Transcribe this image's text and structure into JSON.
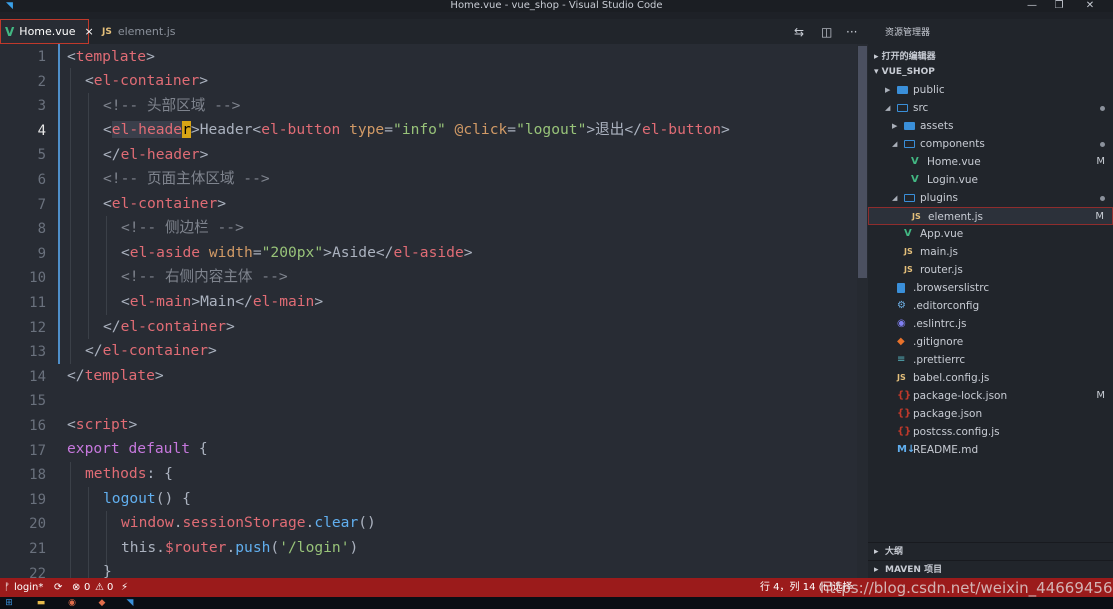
{
  "window": {
    "title": "Home.vue - vue_shop - Visual Studio Code",
    "app_icon": "vscode-icon",
    "controls": {
      "minimize": "—",
      "maximize": "❐",
      "close": "✕"
    }
  },
  "tabs": [
    {
      "label": "Home.vue",
      "type_badge": "V",
      "active": true,
      "close": "×"
    },
    {
      "label": "element.js",
      "type_badge": "JS",
      "active": false
    }
  ],
  "editor_actions": [
    "compare-icon",
    "split-icon",
    "more-icon"
  ],
  "editor_actions_glyphs": [
    "⇆",
    "◫",
    "···"
  ],
  "editor": {
    "current_line": 4,
    "lines": [
      {
        "n": "1"
      },
      {
        "n": "2"
      },
      {
        "n": "3"
      },
      {
        "n": "4"
      },
      {
        "n": "5"
      },
      {
        "n": "6"
      },
      {
        "n": "7"
      },
      {
        "n": "8"
      },
      {
        "n": "9"
      },
      {
        "n": "10"
      },
      {
        "n": "11"
      },
      {
        "n": "12"
      },
      {
        "n": "13"
      },
      {
        "n": "14"
      },
      {
        "n": "15"
      },
      {
        "n": "16"
      },
      {
        "n": "17"
      },
      {
        "n": "18"
      },
      {
        "n": "19"
      },
      {
        "n": "20"
      },
      {
        "n": "21"
      },
      {
        "n": "22"
      }
    ],
    "code": {
      "l1": [
        "<",
        "template",
        ">"
      ],
      "l2": [
        "<",
        "el-container",
        ">"
      ],
      "l3": [
        "<!-- ",
        "头部区域",
        " -->"
      ],
      "l4": [
        "<",
        "el-heade",
        "r",
        ">",
        "Header",
        "<",
        "el-button",
        " ",
        "type",
        "=",
        "\"info\"",
        " ",
        "@click",
        "=",
        "\"logout\"",
        ">",
        "退出",
        "</",
        "el-button",
        ">"
      ],
      "l5": [
        "</",
        "el-header",
        ">"
      ],
      "l6": [
        "<!-- ",
        "页面主体区域",
        " -->"
      ],
      "l7": [
        "<",
        "el-container",
        ">"
      ],
      "l8": [
        "<!-- ",
        "侧边栏",
        " -->"
      ],
      "l9": [
        "<",
        "el-aside",
        " ",
        "width",
        "=",
        "\"200px\"",
        ">",
        "Aside",
        "</",
        "el-aside",
        ">"
      ],
      "l10": [
        "<!-- ",
        "右侧内容主体",
        " -->"
      ],
      "l11": [
        "<",
        "el-main",
        ">",
        "Main",
        "</",
        "el-main",
        ">"
      ],
      "l12": [
        "</",
        "el-container",
        ">"
      ],
      "l13": [
        "</",
        "el-container",
        ">"
      ],
      "l14": [
        "</",
        "template",
        ">"
      ],
      "l16": [
        "<",
        "script",
        ">"
      ],
      "l17": [
        "export",
        " ",
        "default",
        " {"
      ],
      "l18": [
        "methods",
        ": {"
      ],
      "l19": [
        "logout",
        "() {"
      ],
      "l20": [
        "window",
        ".",
        "sessionStorage",
        ".",
        "clear",
        "()"
      ],
      "l21": [
        "this",
        ".",
        "$router",
        ".",
        "push",
        "(",
        "'/login'",
        ")"
      ],
      "l22": [
        "}"
      ]
    }
  },
  "sidebar": {
    "title": "资源管理器",
    "sections": {
      "open_editors": "打开的编辑器",
      "project": "VUE_SHOP",
      "outline": "大纲",
      "maven": "MAVEN 项目"
    },
    "tree": [
      {
        "label": "public",
        "kind": "folder",
        "depth": 1,
        "expanded": false
      },
      {
        "label": "src",
        "kind": "folder",
        "depth": 1,
        "expanded": true
      },
      {
        "label": "assets",
        "kind": "folder",
        "depth": 2,
        "expanded": false
      },
      {
        "label": "components",
        "kind": "folder",
        "depth": 2,
        "expanded": true
      },
      {
        "label": "Home.vue",
        "kind": "vue",
        "depth": 3,
        "git": "M"
      },
      {
        "label": "Login.vue",
        "kind": "vue",
        "depth": 3
      },
      {
        "label": "plugins",
        "kind": "folder",
        "depth": 2,
        "expanded": true
      },
      {
        "label": "element.js",
        "kind": "js",
        "depth": 3,
        "git": "M",
        "selected": true
      },
      {
        "label": "App.vue",
        "kind": "vue",
        "depth": 2
      },
      {
        "label": "main.js",
        "kind": "js",
        "depth": 2
      },
      {
        "label": "router.js",
        "kind": "js",
        "depth": 2
      },
      {
        "label": ".browserslistrc",
        "kind": "file",
        "depth": 1
      },
      {
        "label": ".editorconfig",
        "kind": "config",
        "depth": 1
      },
      {
        "label": ".eslintrc.js",
        "kind": "eslint",
        "depth": 1
      },
      {
        "label": ".gitignore",
        "kind": "git",
        "depth": 1
      },
      {
        "label": ".prettierrc",
        "kind": "prettier",
        "depth": 1
      },
      {
        "label": "babel.config.js",
        "kind": "js",
        "depth": 1
      },
      {
        "label": "package-lock.json",
        "kind": "json",
        "depth": 1,
        "git": "M"
      },
      {
        "label": "package.json",
        "kind": "json",
        "depth": 1
      },
      {
        "label": "postcss.config.js",
        "kind": "json",
        "depth": 1
      },
      {
        "label": "README.md",
        "kind": "md",
        "depth": 1
      }
    ],
    "tree_glyphs": {
      "collapsed": "▶",
      "expanded": "◢",
      "vue": "V",
      "js": "JS",
      "json": "{}",
      "md": "M↓",
      "config": "⚙",
      "eslint": "◉",
      "git": "◆",
      "prettier": "≡"
    }
  },
  "statusbar": {
    "branch": "login*",
    "branch_icon": "git-branch-icon",
    "sync_icon": "sync-icon",
    "errors": "0",
    "warnings": "0",
    "lightning": "⚡",
    "position": "行 4，列 14 (已选择",
    "glyphs": {
      "branch": "ᚠ",
      "sync": "⟳",
      "error": "⊗",
      "warning": "⚠"
    },
    "watermark": "https://blog.csdn.net/weixin_44669456"
  },
  "taskbar": {
    "icons": [
      "windows-start-icon",
      "explorer-icon",
      "chrome-icon",
      "app-icon",
      "vscode-taskbar-icon"
    ],
    "glyphs": [
      "⊞",
      "▬",
      "◉",
      "◆",
      "◥"
    ],
    "colors": [
      "#3a8fd9",
      "#e5b94b",
      "#e06c4a",
      "#e06c4a",
      "#3a8fd9"
    ]
  },
  "colors": {
    "accent_status": "#9b1b1b",
    "vue_green": "#42b883",
    "js_yellow": "#e5c07b",
    "folder_blue": "#3a8fd9"
  }
}
